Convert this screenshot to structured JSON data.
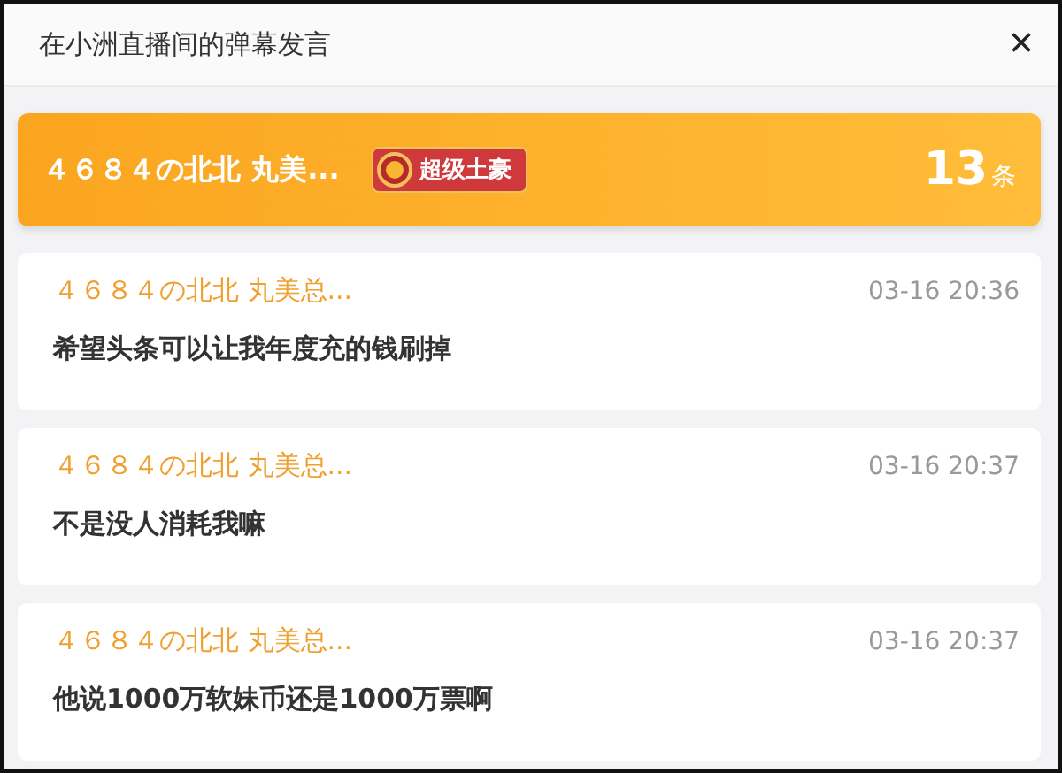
{
  "window": {
    "title": "在小洲直播间的弹幕发言",
    "close": "×"
  },
  "summary": {
    "user": "４６８４の北北 丸美...",
    "badge": "超级土豪",
    "count": "13",
    "unit": "条"
  },
  "messages": [
    {
      "user": "４６８４の北北 丸美总...",
      "time": "03-16 20:36",
      "text": "希望头条可以让我年度充的钱刷掉"
    },
    {
      "user": "４６８４の北北 丸美总...",
      "time": "03-16 20:37",
      "text": "不是没人消耗我嘛"
    },
    {
      "user": "４６８４の北北 丸美总...",
      "time": "03-16 20:37",
      "text": "他说1000万软妹币还是1000万票啊"
    }
  ]
}
